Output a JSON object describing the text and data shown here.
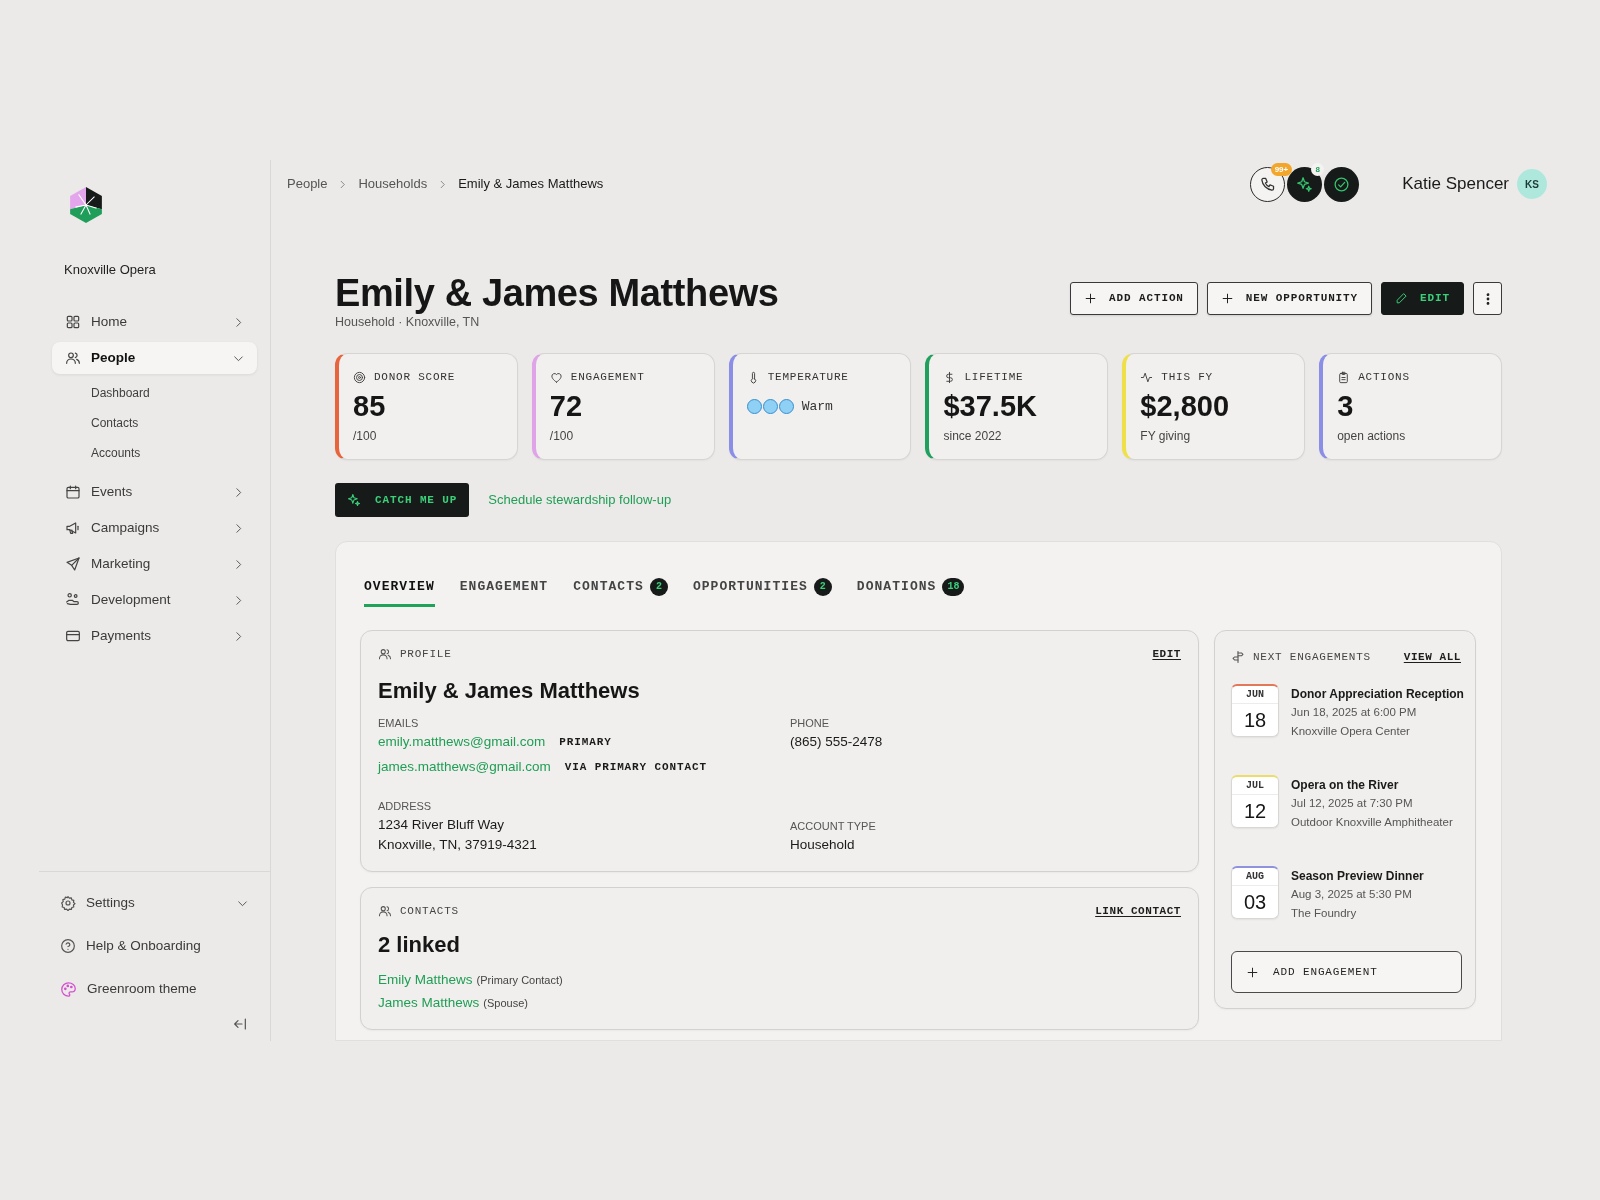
{
  "sidebar": {
    "org_name": "Knoxville Opera",
    "nav": [
      {
        "label": "Home",
        "selected": false,
        "expanded": false
      },
      {
        "label": "People",
        "selected": true,
        "expanded": true,
        "children": [
          {
            "label": "Dashboard",
            "selected": false
          },
          {
            "label": "Contacts",
            "selected": false
          },
          {
            "label": "Accounts",
            "selected": false
          }
        ]
      },
      {
        "label": "Events",
        "selected": false,
        "expanded": false
      },
      {
        "label": "Campaigns",
        "selected": false,
        "expanded": false
      },
      {
        "label": "Marketing",
        "selected": false,
        "expanded": false
      },
      {
        "label": "Development",
        "selected": false,
        "expanded": false
      },
      {
        "label": "Payments",
        "selected": false,
        "expanded": false
      }
    ],
    "footer": [
      {
        "label": "Settings",
        "kind": "dropdown"
      },
      {
        "label": "Help & Onboarding",
        "kind": "link"
      },
      {
        "label": "Greenroom theme",
        "kind": "theme"
      }
    ]
  },
  "header": {
    "breadcrumb": [
      {
        "label": "People",
        "current": false
      },
      {
        "label": "Households",
        "current": false
      },
      {
        "label": "Emily & James Matthews",
        "current": true
      }
    ],
    "quick_actions": [
      {
        "kind": "light",
        "badge": "99+"
      },
      {
        "kind": "dark",
        "badge": "8"
      },
      {
        "kind": "dark"
      }
    ],
    "user": {
      "name": "Katie Spencer",
      "initials": "KS"
    }
  },
  "page": {
    "title": "Emily & James Matthews",
    "subtitle": "Household · Knoxville, TN",
    "actions": [
      {
        "kind": "outline",
        "label": "ADD ACTION"
      },
      {
        "kind": "outline",
        "label": "NEW OPPORTUNITY"
      },
      {
        "kind": "primary",
        "label": "EDIT"
      },
      {
        "kind": "more"
      }
    ]
  },
  "stats": [
    {
      "kind": "number",
      "label": "DONOR SCORE",
      "value": "85",
      "note": "/100",
      "color": "#e8643c"
    },
    {
      "kind": "number",
      "label": "ENGAGEMENT",
      "value": "72",
      "note": "/100",
      "color": "#dfa3e8"
    },
    {
      "kind": "rating",
      "label": "TEMPERATURE",
      "stars": 3,
      "value": "Warm",
      "color": "#8a8ee6"
    },
    {
      "kind": "number",
      "label": "LIFETIME",
      "value": "$37.5K",
      "note": "since 2022",
      "color": "#20a05c"
    },
    {
      "kind": "number",
      "label": "THIS FY",
      "value": "$2,800",
      "note": "FY giving",
      "color": "#efe04a"
    },
    {
      "kind": "number",
      "label": "ACTIONS",
      "value": "3",
      "note": "open actions",
      "color": "#8a8ee6"
    }
  ],
  "catch_up": {
    "button": "CATCH ME UP",
    "link": "Schedule stewardship follow-up"
  },
  "tabs": [
    {
      "label": "OVERVIEW",
      "selected": true
    },
    {
      "label": "ENGAGEMENT",
      "selected": false
    },
    {
      "label": "CONTACTS",
      "count": "2",
      "selected": false
    },
    {
      "label": "OPPORTUNITIES",
      "count": "2",
      "selected": false
    },
    {
      "label": "DONATIONS",
      "count": "18",
      "selected": false
    }
  ],
  "profile": {
    "heading": "PROFILE",
    "action": "EDIT",
    "name": "Emily & James Matthews",
    "emails_label": "EMAILS",
    "emails": [
      {
        "address": "emily.matthews@gmail.com",
        "tag": "PRIMARY"
      },
      {
        "address": "james.matthews@gmail.com",
        "tag": "VIA PRIMARY CONTACT"
      }
    ],
    "phone_label": "PHONE",
    "phone": "(865) 555-2478",
    "address_label": "ADDRESS",
    "address_lines": [
      "1234 River Bluff Way",
      "Knoxville, TN, 37919-4321"
    ],
    "account_type_label": "ACCOUNT TYPE",
    "account_type": "Household"
  },
  "contacts": {
    "heading": "CONTACTS",
    "action": "LINK CONTACT",
    "summary": "2 linked",
    "items": [
      {
        "name": "Emily Matthews",
        "role": "(Primary Contact)"
      },
      {
        "name": "James Matthews",
        "role": "(Spouse)"
      }
    ]
  },
  "next_engagements": {
    "heading": "NEXT ENGAGEMENTS",
    "action": "VIEW ALL",
    "events": [
      {
        "month": "JUN",
        "day": "18",
        "title": "Donor Appreciation Reception",
        "when": "Jun 18, 2025 at 6:00 PM",
        "where": "Knoxville Opera Center",
        "color": "#e2775a"
      },
      {
        "month": "JUL",
        "day": "12",
        "title": "Opera on the River",
        "when": "Jul 12, 2025 at 7:30 PM",
        "where": "Outdoor Knoxville Amphitheater",
        "color": "#eedc6a"
      },
      {
        "month": "AUG",
        "day": "03",
        "title": "Season Preview Dinner",
        "when": "Aug 3, 2025 at 5:30 PM",
        "where": "The Foundry",
        "color": "#8f93dd"
      }
    ],
    "button": "ADD ENGAGEMENT"
  }
}
